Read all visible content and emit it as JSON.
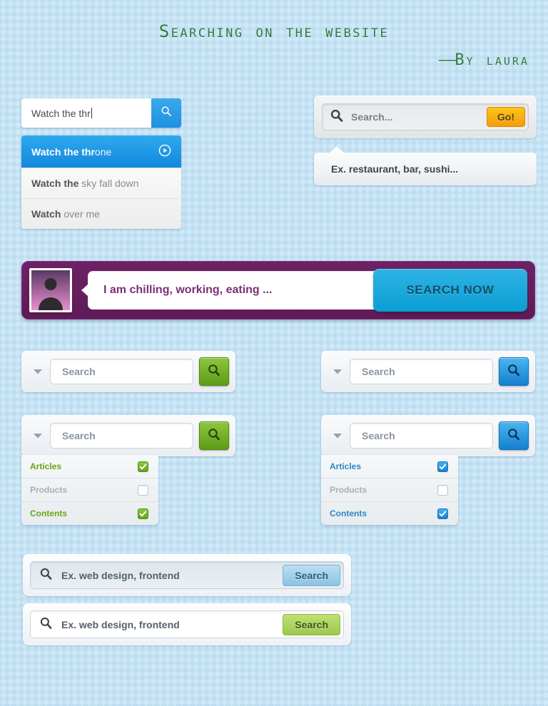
{
  "header": {
    "title": "Searching on the website",
    "byline_dash": "——",
    "byline": "By laura"
  },
  "autocomplete_widget": {
    "input_value": "Watch the thr",
    "search_icon": "magnifier-icon",
    "suggestions": [
      {
        "match": "Watch the thr",
        "rest": "one",
        "selected": true,
        "icon": "play-circle-icon"
      },
      {
        "match": "Watch the",
        "rest": " sky fall down",
        "selected": false
      },
      {
        "match": "Watch",
        "rest": " over me",
        "selected": false
      }
    ]
  },
  "go_widget": {
    "search_icon": "magnifier-icon",
    "placeholder": "Search...",
    "button_label": "Go!",
    "tooltip": "Ex. restaurant, bar, sushi...",
    "button_color": "#fdc418"
  },
  "purple_widget": {
    "avatar": "user-avatar",
    "input_value": "I am chilling, working, eating ...",
    "button_label": "SEARCH NOW",
    "bar_color": "#6e2166",
    "button_color": "#0b9ed2"
  },
  "select_search_green": {
    "chevron_icon": "chevron-down-icon",
    "placeholder": "Search",
    "search_icon": "magnifier-icon",
    "button_color": "#5d9c16"
  },
  "select_search_blue": {
    "chevron_icon": "chevron-down-icon",
    "placeholder": "Search",
    "search_icon": "magnifier-icon",
    "button_color": "#1480cf"
  },
  "select_dropdown_green": {
    "chevron_icon": "chevron-down-icon",
    "placeholder": "Search",
    "search_icon": "magnifier-icon",
    "options": [
      {
        "label": "Articles",
        "checked": true
      },
      {
        "label": "Products",
        "checked": false
      },
      {
        "label": "Contents",
        "checked": true
      }
    ]
  },
  "select_dropdown_blue": {
    "chevron_icon": "chevron-down-icon",
    "placeholder": "Search",
    "search_icon": "magnifier-icon",
    "options": [
      {
        "label": "Articles",
        "checked": true
      },
      {
        "label": "Products",
        "checked": false
      },
      {
        "label": "Contents",
        "checked": true
      }
    ]
  },
  "bottom_bar_blue": {
    "search_icon": "magnifier-icon",
    "placeholder": "Ex. web design, frontend",
    "button_label": "Search",
    "button_color": "#8bc2e2"
  },
  "bottom_bar_green": {
    "search_icon": "magnifier-icon",
    "placeholder": "Ex. web design, frontend",
    "button_label": "Search",
    "button_color": "#9ac94c"
  }
}
